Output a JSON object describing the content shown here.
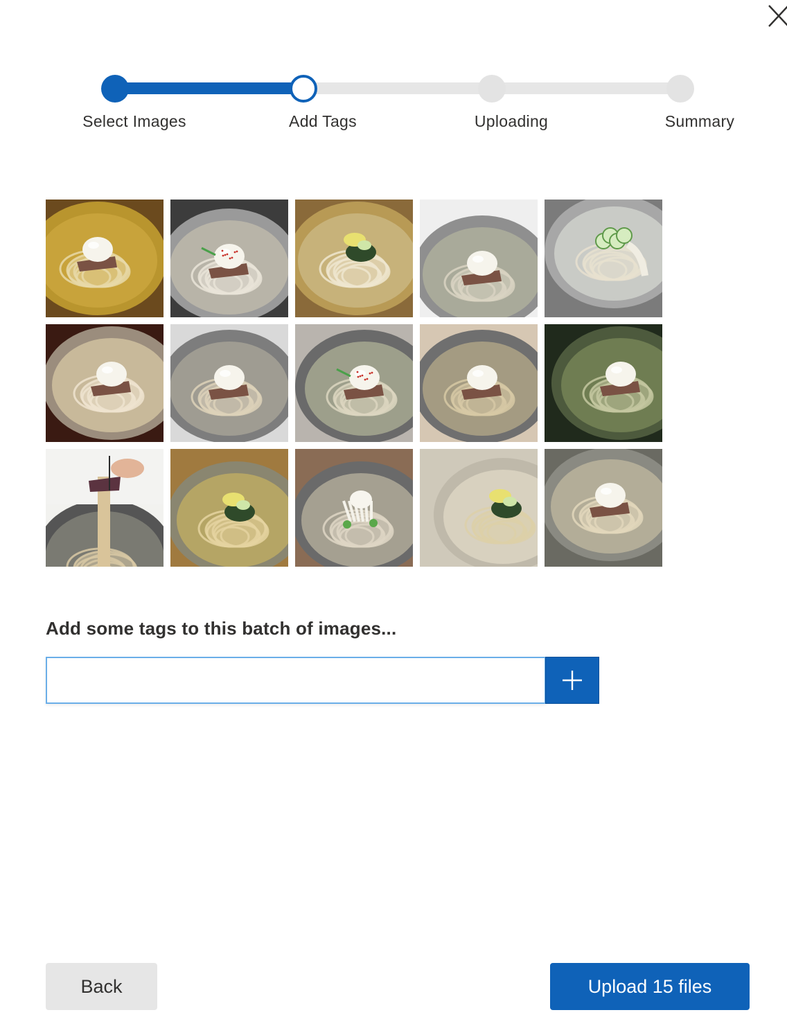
{
  "colors": {
    "accent": "#0f62b8",
    "track_pending": "#e6e6e6",
    "text": "#323130"
  },
  "close_icon": "close-icon",
  "stepper": {
    "steps": [
      {
        "label": "Select Images",
        "state": "completed"
      },
      {
        "label": "Add Tags",
        "state": "current"
      },
      {
        "label": "Uploading",
        "state": "pending"
      },
      {
        "label": "Summary",
        "state": "pending"
      }
    ]
  },
  "thumbnails": [
    {
      "variant": "golden-egg"
    },
    {
      "variant": "clear-egg-red"
    },
    {
      "variant": "golden-greens"
    },
    {
      "variant": "side-dishes"
    },
    {
      "variant": "cucumber-clear"
    },
    {
      "variant": "dark-egg"
    },
    {
      "variant": "grey-bowl"
    },
    {
      "variant": "red-table"
    },
    {
      "variant": "table-egg"
    },
    {
      "variant": "green-broth"
    },
    {
      "variant": "chopsticks"
    },
    {
      "variant": "wood-table"
    },
    {
      "variant": "radish"
    },
    {
      "variant": "close-up"
    },
    {
      "variant": "egg-close"
    }
  ],
  "tags": {
    "prompt": "Add some tags to this batch of images...",
    "input_value": "",
    "add_icon": "plus-icon"
  },
  "footer": {
    "back_label": "Back",
    "upload_label": "Upload 15 files"
  }
}
